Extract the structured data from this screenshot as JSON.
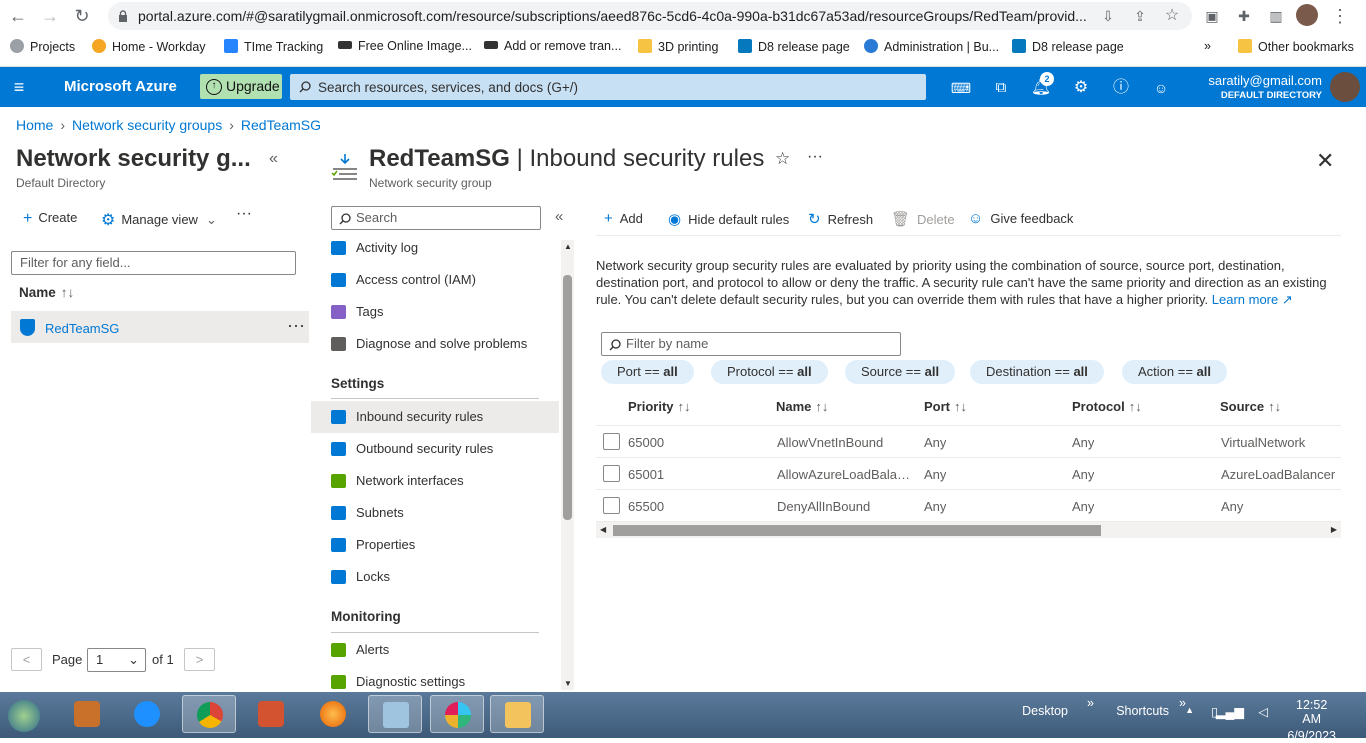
{
  "browser": {
    "url": "portal.azure.com/#@saratilygmail.onmicrosoft.com/resource/subscriptions/aeed876c-5cd6-4c0a-990a-b31dc67a53ad/resourceGroups/RedTeam/provid...",
    "bookmarks": [
      "Projects",
      "Home - Workday",
      "TIme Tracking",
      "Free Online Image...",
      "Add or remove tran...",
      "3D printing",
      "D8 release page",
      "Administration | Bu...",
      "D8 release page"
    ],
    "other_bookmarks": "Other bookmarks",
    "more": "»"
  },
  "topbar": {
    "brand": "Microsoft Azure",
    "upgrade": "Upgrade",
    "search_placeholder": "Search resources, services, and docs (G+/)",
    "notifications_count": "2",
    "account_email": "saratily@gmail.com",
    "account_directory": "DEFAULT DIRECTORY"
  },
  "breadcrumb": [
    "Home",
    "Network security groups",
    "RedTeamSG"
  ],
  "left_pane": {
    "title": "Network security g...",
    "subtitle": "Default Directory",
    "create": "Create",
    "manage_view": "Manage view",
    "filter_placeholder": "Filter for any field...",
    "name_header": "Name",
    "item": "RedTeamSG",
    "page_label": "Page",
    "page_value": "1",
    "page_of": "of 1"
  },
  "resource": {
    "name": "RedTeamSG",
    "sep": " | ",
    "blade": "Inbound security rules",
    "type": "Network security group",
    "menu_search": "Search",
    "menu": [
      {
        "label": "Activity log",
        "color": "#0078d4"
      },
      {
        "label": "Access control (IAM)",
        "color": "#0078d4"
      },
      {
        "label": "Tags",
        "color": "#8661c5"
      },
      {
        "label": "Diagnose and solve problems",
        "color": "#605e5c"
      }
    ],
    "settings_header": "Settings",
    "settings": [
      {
        "label": "Inbound security rules",
        "color": "#0078d4",
        "selected": true
      },
      {
        "label": "Outbound security rules",
        "color": "#0078d4"
      },
      {
        "label": "Network interfaces",
        "color": "#57a300"
      },
      {
        "label": "Subnets",
        "color": "#0078d4"
      },
      {
        "label": "Properties",
        "color": "#0078d4"
      },
      {
        "label": "Locks",
        "color": "#0078d4"
      }
    ],
    "monitoring_header": "Monitoring",
    "monitoring": [
      {
        "label": "Alerts",
        "color": "#57a300"
      },
      {
        "label": "Diagnostic settings",
        "color": "#57a300"
      }
    ]
  },
  "commands": {
    "add": "Add",
    "hide_default": "Hide default rules",
    "refresh": "Refresh",
    "delete": "Delete",
    "feedback": "Give feedback"
  },
  "description": "Network security group security rules are evaluated by priority using the combination of source, source port, destination, destination port, and protocol to allow or deny the traffic. A security rule can't have the same priority and direction as an existing rule. You can't delete default security rules, but you can override them with rules that have a higher priority.",
  "learn_more": "Learn more",
  "filter_placeholder": "Filter by name",
  "pills": [
    {
      "key": "Port == ",
      "val": "all"
    },
    {
      "key": "Protocol == ",
      "val": "all"
    },
    {
      "key": "Source == ",
      "val": "all"
    },
    {
      "key": "Destination == ",
      "val": "all"
    },
    {
      "key": "Action == ",
      "val": "all"
    }
  ],
  "table": {
    "headers": [
      "Priority",
      "Name",
      "Port",
      "Protocol",
      "Source"
    ],
    "sort_glyph": "↑↓",
    "rows": [
      {
        "priority": "65000",
        "name": "AllowVnetInBound",
        "port": "Any",
        "protocol": "Any",
        "source": "VirtualNetwork"
      },
      {
        "priority": "65001",
        "name": "AllowAzureLoadBalan...",
        "port": "Any",
        "protocol": "Any",
        "source": "AzureLoadBalancer"
      },
      {
        "priority": "65500",
        "name": "DenyAllInBound",
        "port": "Any",
        "protocol": "Any",
        "source": "Any"
      }
    ]
  },
  "taskbar": {
    "desktop": "Desktop",
    "shortcuts": "Shortcuts",
    "time": "12:52 AM",
    "date": "6/9/2023"
  },
  "colors": {
    "azure_blue": "#0078d4",
    "upgrade_green": "#b1e0b1",
    "search_bg": "#c7e0f4"
  }
}
